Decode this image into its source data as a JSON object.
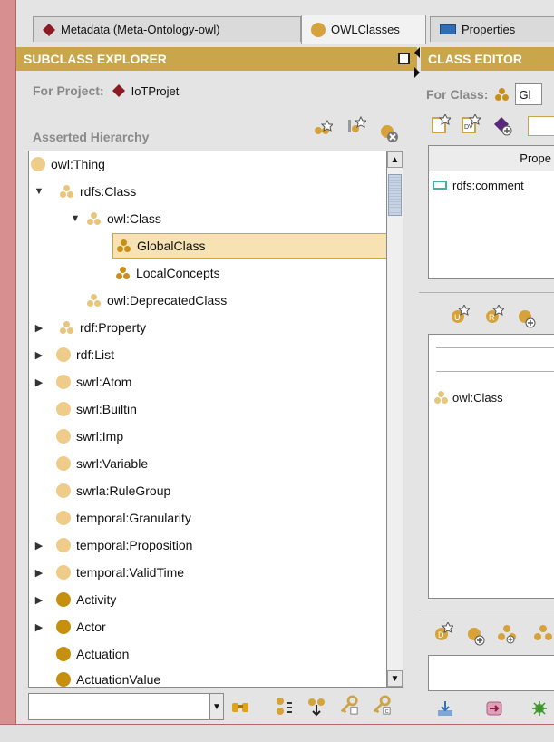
{
  "tabs": [
    {
      "label": "Metadata (Meta-Ontology-owl)",
      "icon": "metadata-icon"
    },
    {
      "label": "OWLClasses",
      "icon": "owlclasses-icon"
    },
    {
      "label": "Properties",
      "icon": "properties-icon"
    }
  ],
  "subclass_explorer": {
    "title": "SUBCLASS EXPLORER",
    "project_label": "For Project:",
    "project_name": "IoTProjet",
    "hierarchy_label": "Asserted Hierarchy",
    "tree": [
      {
        "label": "owl:Thing",
        "icon": "ball-light",
        "arrow": ""
      },
      {
        "label": "rdfs:Class",
        "icon": "tri-faded",
        "arrow": "down"
      },
      {
        "label": "owl:Class",
        "icon": "tri-faded",
        "arrow": "down"
      },
      {
        "label": "GlobalClass",
        "icon": "tri-solid",
        "arrow": "",
        "selected": true
      },
      {
        "label": "LocalConcepts",
        "icon": "tri-solid",
        "arrow": ""
      },
      {
        "label": "owl:DeprecatedClass",
        "icon": "tri-faded",
        "arrow": ""
      },
      {
        "label": "rdf:Property",
        "icon": "tri-faded",
        "arrow": "right"
      },
      {
        "label": "rdf:List",
        "icon": "ball-light",
        "arrow": "right"
      },
      {
        "label": "swrl:Atom",
        "icon": "ball-light",
        "arrow": "right"
      },
      {
        "label": "swrl:Builtin",
        "icon": "ball-light",
        "arrow": ""
      },
      {
        "label": "swrl:Imp",
        "icon": "ball-light",
        "arrow": ""
      },
      {
        "label": "swrl:Variable",
        "icon": "ball-light",
        "arrow": ""
      },
      {
        "label": "swrla:RuleGroup",
        "icon": "ball-light",
        "arrow": ""
      },
      {
        "label": "temporal:Granularity",
        "icon": "ball-light",
        "arrow": ""
      },
      {
        "label": "temporal:Proposition",
        "icon": "ball-light",
        "arrow": "right"
      },
      {
        "label": "temporal:ValidTime",
        "icon": "ball-light",
        "arrow": "right"
      },
      {
        "label": "Activity",
        "icon": "ball-dark",
        "arrow": "right"
      },
      {
        "label": "Actor",
        "icon": "ball-dark",
        "arrow": "right"
      },
      {
        "label": "Actuation",
        "icon": "ball-dark",
        "arrow": ""
      },
      {
        "label": "ActuationValue",
        "icon": "ball-dark",
        "arrow": ""
      }
    ]
  },
  "class_editor": {
    "title": "CLASS EDITOR",
    "class_label": "For Class:",
    "class_value": "Gl",
    "table_header": "Prope",
    "property_row": "rdfs:comment",
    "superclass_item": "owl:Class"
  },
  "colors": {
    "header": "#c9a64a",
    "selected": "#f6e2b3",
    "frame": "#d88f8f"
  }
}
